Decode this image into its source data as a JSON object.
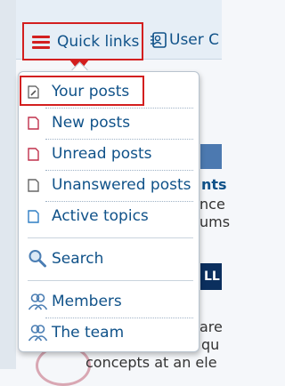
{
  "navbar": {
    "quick_links_label": "Quick links",
    "user_label": "User C"
  },
  "dropdown": {
    "items": [
      {
        "label": "Your posts",
        "icon": "post-icon"
      },
      {
        "label": "New posts",
        "icon": "new-post-icon"
      },
      {
        "label": "Unread posts",
        "icon": "unread-post-icon"
      },
      {
        "label": "Unanswered posts",
        "icon": "unanswered-post-icon"
      },
      {
        "label": "Active topics",
        "icon": "active-topic-icon"
      },
      {
        "label": "Search",
        "icon": "search-icon"
      },
      {
        "label": "Members",
        "icon": "members-icon"
      },
      {
        "label": "The team",
        "icon": "team-icon"
      }
    ]
  },
  "background": {
    "text_1": "nts",
    "text_2": "nce",
    "text_3": "ums",
    "strip_text": "LL",
    "text_4": "are",
    "text_5": "qu",
    "text_6": "concepts at an ele"
  },
  "colors": {
    "accent_red": "#d31f1f",
    "link_blue": "#105289"
  }
}
